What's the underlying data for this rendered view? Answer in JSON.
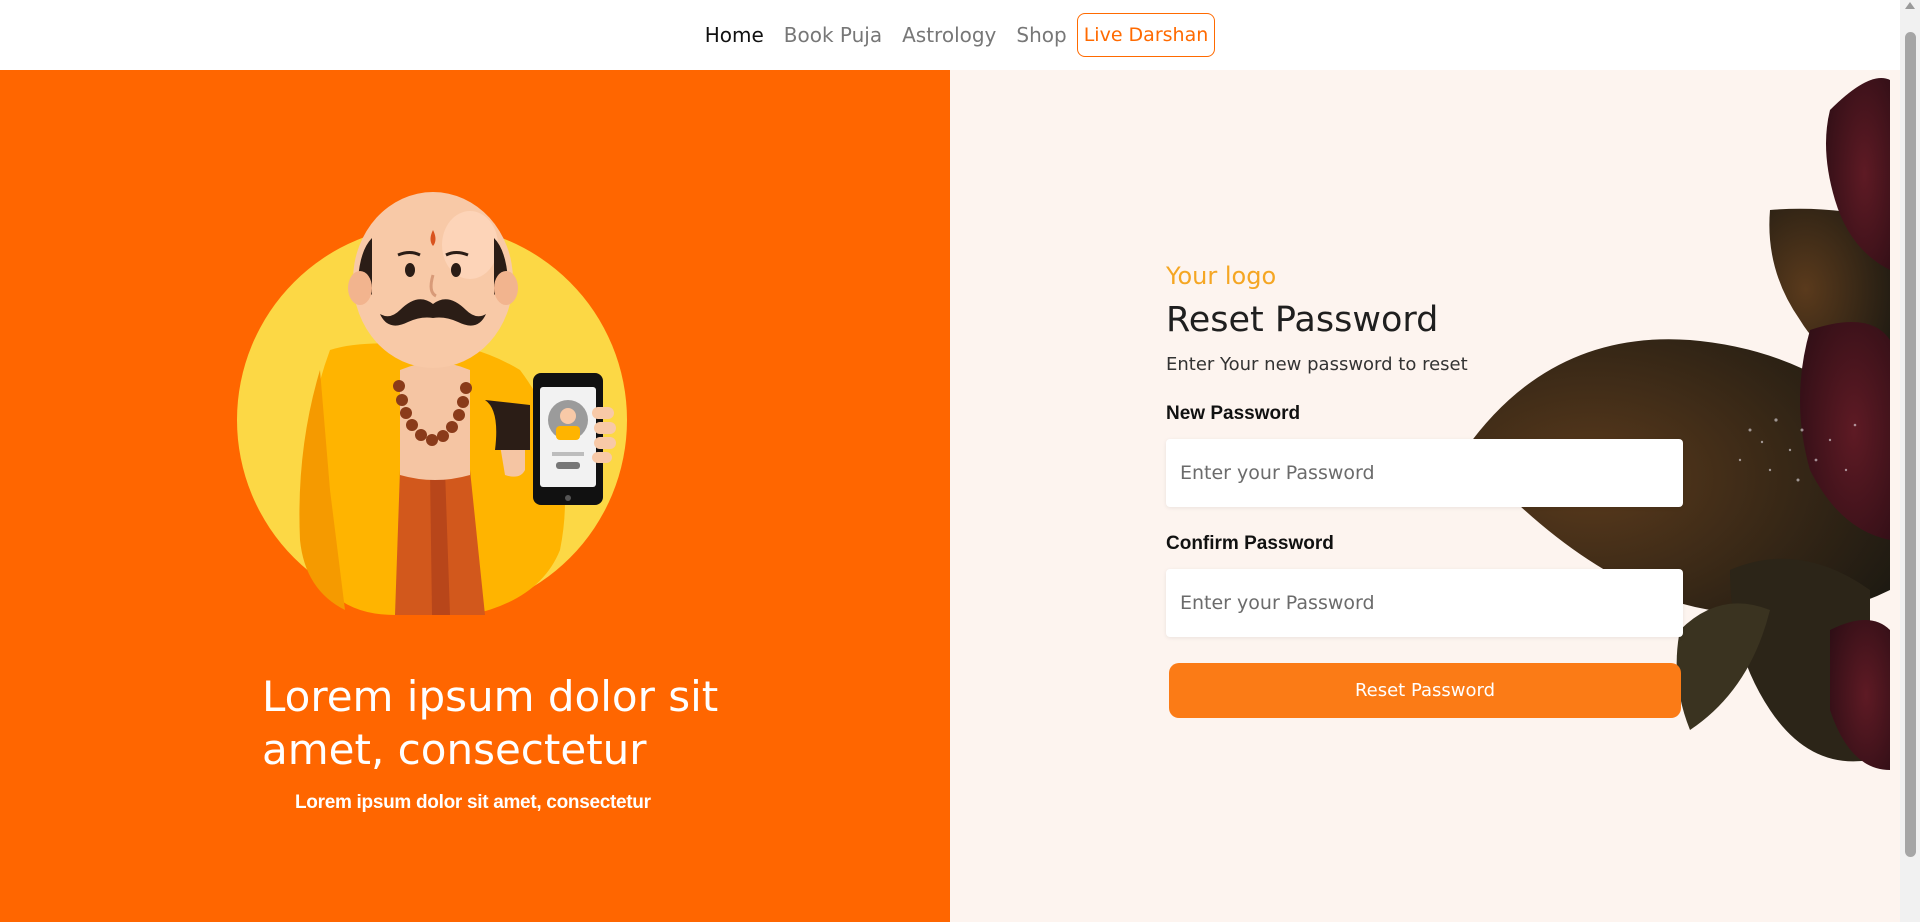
{
  "nav": {
    "items": [
      {
        "label": "Home",
        "active": true
      },
      {
        "label": "Book Puja",
        "active": false
      },
      {
        "label": "Astrology",
        "active": false
      },
      {
        "label": "Shop",
        "active": false
      }
    ],
    "cta_label": "Live Darshan"
  },
  "hero": {
    "title": "Lorem ipsum dolor sit amet, consectetur",
    "subtitle": "Lorem ipsum dolor sit amet, consectetur",
    "illustration": "priest-holding-phone-illustration"
  },
  "form": {
    "logo_text": "Your logo",
    "title": "Reset Password",
    "subtitle": "Enter Your new password to reset",
    "new_password": {
      "label": "New Password",
      "placeholder": "Enter your Password",
      "value": ""
    },
    "confirm_password": {
      "label": "Confirm Password",
      "placeholder": "Enter your Password",
      "value": ""
    },
    "submit_label": "Reset Password"
  },
  "colors": {
    "brand_orange": "#ff6600",
    "button_orange": "#fb7b16",
    "logo_gold": "#f5a623",
    "panel_cream": "#fdf4ef"
  }
}
